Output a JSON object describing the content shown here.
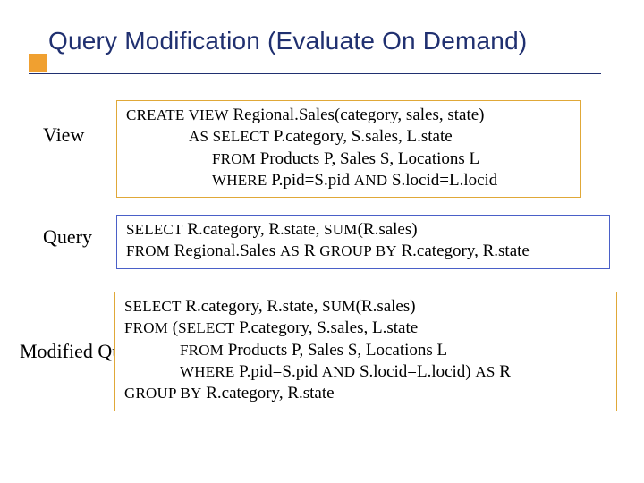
{
  "title": "Query Modification (Evaluate On Demand)",
  "labels": {
    "view": "View",
    "query": "Query",
    "modified": "Modified Query"
  },
  "kw": {
    "create_view": "CREATE VIEW",
    "as_select": "AS SELECT",
    "from": "FROM",
    "where": "WHERE",
    "and": "AND",
    "select": "SELECT",
    "sum": "SUM",
    "as": "AS",
    "group_by": "GROUP BY"
  },
  "view": {
    "name": " Regional.Sales(category, sales, state)",
    "cols": " P.category, S.sales, L.state",
    "tables": " Products P, Sales S, Locations L",
    "w1": " P.pid=S.pid ",
    "w2": " S.locid=L.locid"
  },
  "query": {
    "sel_a": " R.category, R.state, ",
    "sel_b": "(R.sales)",
    "from_a": " Regional.Sales ",
    "from_b": " R ",
    "grp": " R.category, R.state"
  },
  "mod": {
    "sel_a": " R.category, R.state, ",
    "sel_b": "(R.sales)",
    "open": " (",
    "sub_cols": " P.category, S.sales, L.state",
    "sub_tables": " Products P, Sales S, Locations L",
    "sub_w1": " P.pid=S.pid ",
    "sub_w2": " S.locid=L.locid) ",
    "as_r": " R",
    "grp": " R.category, R.state"
  }
}
